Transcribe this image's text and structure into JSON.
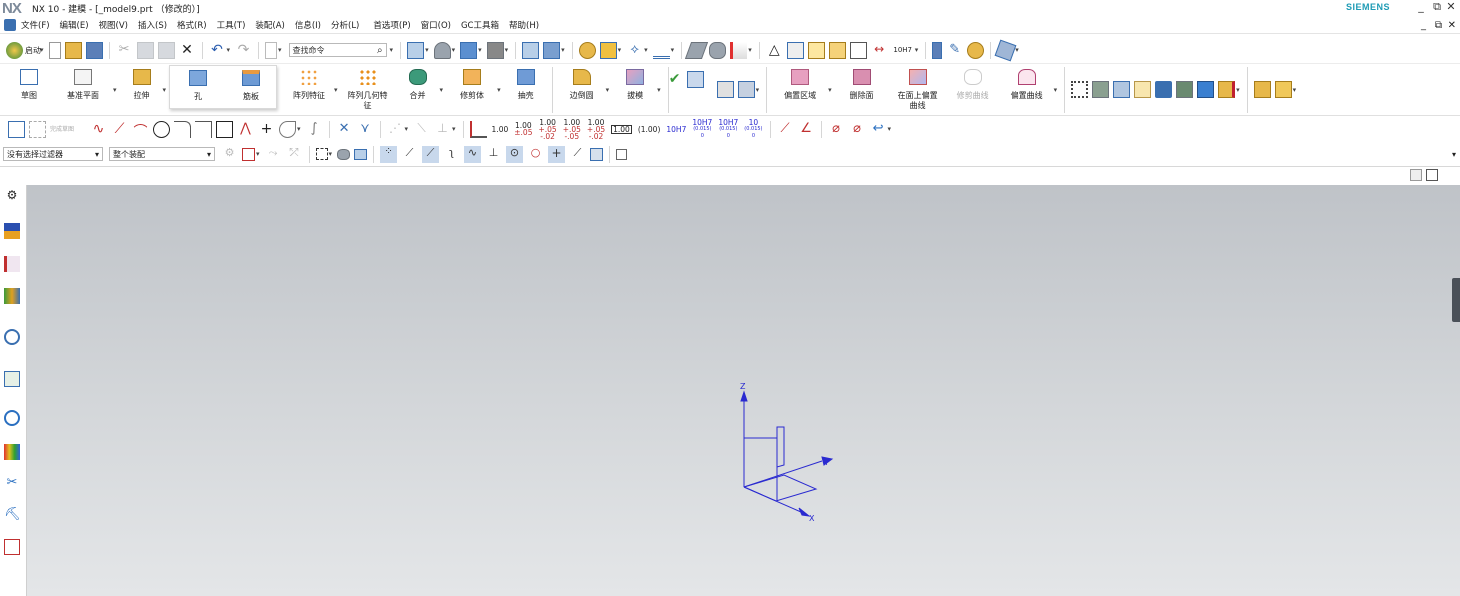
{
  "window": {
    "logo": "NX",
    "title": "NX 10 - 建模 - [_model9.prt （修改的）]",
    "brand": "SIEMENS"
  },
  "menu": [
    "文件(F)",
    "编辑(E)",
    "视图(V)",
    "插入(S)",
    "格式(R)",
    "工具(T)",
    "装配(A)",
    "信息(I)",
    "分析(L)",
    "首选项(P)",
    "窗口(O)",
    "GC工具箱",
    "帮助(H)"
  ],
  "toolbar": {
    "start_label": "启动",
    "search_placeholder": "查找命令"
  },
  "ribbon": {
    "sketch": "草图",
    "datum_plane": "基准平面",
    "extrude": "拉伸",
    "hole": "孔",
    "rib": "筋板",
    "pattern_feature": "阵列特征",
    "pattern_geometry": "阵列几何特\n征",
    "unite": "合并",
    "trim_body": "修剪体",
    "shell": "抽壳",
    "edge_blend": "边倒圆",
    "draft": "拔模",
    "offset_region": "偏置区域",
    "delete_face": "删除面",
    "offset_curve_on_face": "在面上偏置\n曲线",
    "trim_curve": "修剪曲线",
    "offset_curve": "偏置曲线"
  },
  "dimension_labels": {
    "d1": "1.00",
    "d2a": "1.00",
    "d2b": "±.05",
    "d3a": "1.00",
    "d3b": "+.05",
    "d3c": "-.02",
    "d4a": "1.00",
    "d4b": "+.05",
    "d4c": "-.05",
    "d5a": "1.00",
    "d5b": "+.05",
    "d5c": "-.02",
    "d6": "1.00",
    "d7": "(1.00)",
    "fit1": "10H7",
    "fit2a": "10H7",
    "fit2b": "(0.015)",
    "fit2c": "0",
    "fit3a": "10H7",
    "fit3b": "(0.015)",
    "fit3c": "0",
    "fit4a": "10",
    "fit4b": "(0.015)",
    "fit4c": "0"
  },
  "selection": {
    "filter_value": "没有选择过滤器",
    "scope_value": "整个装配"
  },
  "axes": {
    "x": "X",
    "y": "Y",
    "z": "Z"
  },
  "colors": {
    "axis": "#2a2ad0",
    "brand": "#1d9bb5"
  }
}
